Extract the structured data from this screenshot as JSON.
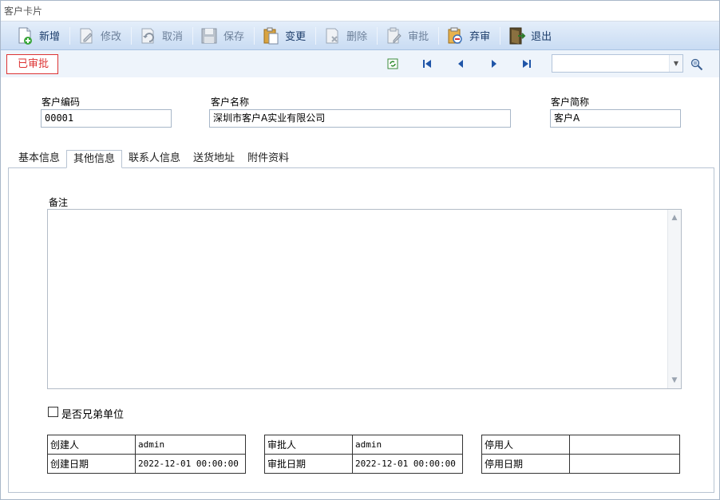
{
  "window": {
    "title": "客户卡片"
  },
  "toolbar": {
    "buttons": [
      {
        "label": "新增",
        "icon": "new-doc-icon",
        "enabled": true
      },
      {
        "label": "修改",
        "icon": "edit-icon",
        "enabled": false
      },
      {
        "label": "取消",
        "icon": "undo-icon",
        "enabled": false
      },
      {
        "label": "保存",
        "icon": "save-icon",
        "enabled": false
      },
      {
        "label": "变更",
        "icon": "clipboard-icon",
        "enabled": true
      },
      {
        "label": "删除",
        "icon": "delete-icon",
        "enabled": false
      },
      {
        "label": "审批",
        "icon": "approve-icon",
        "enabled": false
      },
      {
        "label": "弃审",
        "icon": "unapprove-icon",
        "enabled": true
      },
      {
        "label": "退出",
        "icon": "exit-icon",
        "enabled": true
      }
    ]
  },
  "status": {
    "badge": "已审批"
  },
  "header_fields": {
    "code": {
      "label": "客户编码",
      "value": "00001"
    },
    "name": {
      "label": "客户名称",
      "value": "深圳市客户A实业有限公司"
    },
    "short_name": {
      "label": "客户简称",
      "value": "客户A"
    }
  },
  "tabs": [
    {
      "label": "基本信息",
      "active": false
    },
    {
      "label": "其他信息",
      "active": true
    },
    {
      "label": "联系人信息",
      "active": false
    },
    {
      "label": "送货地址",
      "active": false
    },
    {
      "label": "附件资料",
      "active": false
    }
  ],
  "other_info": {
    "memo_label": "备注",
    "memo_value": "",
    "sibling_unit": {
      "label": "是否兄弟单位",
      "checked": false
    }
  },
  "audit": {
    "creator": {
      "label": "创建人",
      "value": "admin"
    },
    "created_at": {
      "label": "创建日期",
      "value": "2022-12-01 00:00:00"
    },
    "approver": {
      "label": "审批人",
      "value": "admin"
    },
    "approved_at": {
      "label": "审批日期",
      "value": "2022-12-01 00:00:00"
    },
    "disabler": {
      "label": "停用人",
      "value": ""
    },
    "disabled_at": {
      "label": "停用日期",
      "value": ""
    }
  },
  "colors": {
    "status_red": "#dd3333",
    "toolbar_text": "#1c3d6b",
    "toolbar_bg": "#c9dcf3"
  }
}
